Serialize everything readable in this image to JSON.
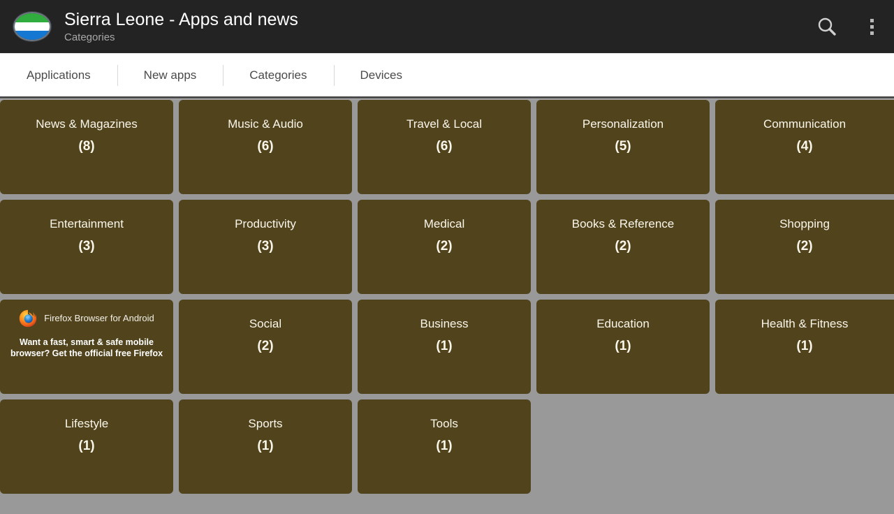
{
  "header": {
    "title": "Sierra Leone - Apps and news",
    "subtitle": "Categories",
    "app_icon": "sierra-leone-flag-icon",
    "search_icon": "search-icon",
    "overflow_icon": "overflow-menu-icon",
    "background_color": "#232323",
    "title_color": "#ffffff",
    "subtitle_color": "#a8a8a8"
  },
  "tabs": [
    {
      "label": "Applications",
      "selected": false
    },
    {
      "label": "New apps",
      "selected": false
    },
    {
      "label": "Categories",
      "selected": true
    },
    {
      "label": "Devices",
      "selected": false
    }
  ],
  "grid": {
    "card_color": "#51441d",
    "card_text_color": "#faf6ea",
    "empty_area_color": "#999999",
    "rows": [
      {
        "cells": [
          {
            "type": "category",
            "label": "News & Magazines",
            "count": "(8)"
          },
          {
            "type": "category",
            "label": "Music & Audio",
            "count": "(6)"
          },
          {
            "type": "category",
            "label": "Travel & Local",
            "count": "(6)"
          },
          {
            "type": "category",
            "label": "Personalization",
            "count": "(5)"
          },
          {
            "type": "category",
            "label": "Communication",
            "count": "(4)"
          }
        ]
      },
      {
        "cells": [
          {
            "type": "category",
            "label": "Entertainment",
            "count": "(3)"
          },
          {
            "type": "category",
            "label": "Productivity",
            "count": "(3)"
          },
          {
            "type": "category",
            "label": "Medical",
            "count": "(2)"
          },
          {
            "type": "category",
            "label": "Books & Reference",
            "count": "(2)"
          },
          {
            "type": "category",
            "label": "Shopping",
            "count": "(2)"
          }
        ]
      },
      {
        "cells": [
          {
            "type": "ad",
            "ad_title": "Firefox Browser for Android",
            "ad_body": "Want a fast, smart & safe mobile browser? Get the official free Firefox",
            "ad_icon": "firefox-logo-icon"
          },
          {
            "type": "category",
            "label": "Social",
            "count": "(2)"
          },
          {
            "type": "category",
            "label": "Business",
            "count": "(1)"
          },
          {
            "type": "category",
            "label": "Education",
            "count": "(1)"
          },
          {
            "type": "category",
            "label": "Health & Fitness",
            "count": "(1)"
          }
        ]
      },
      {
        "cells": [
          {
            "type": "category",
            "label": "Lifestyle",
            "count": "(1)"
          },
          {
            "type": "category",
            "label": "Sports",
            "count": "(1)"
          },
          {
            "type": "category",
            "label": "Tools",
            "count": "(1)"
          },
          {
            "type": "empty"
          }
        ]
      }
    ]
  }
}
